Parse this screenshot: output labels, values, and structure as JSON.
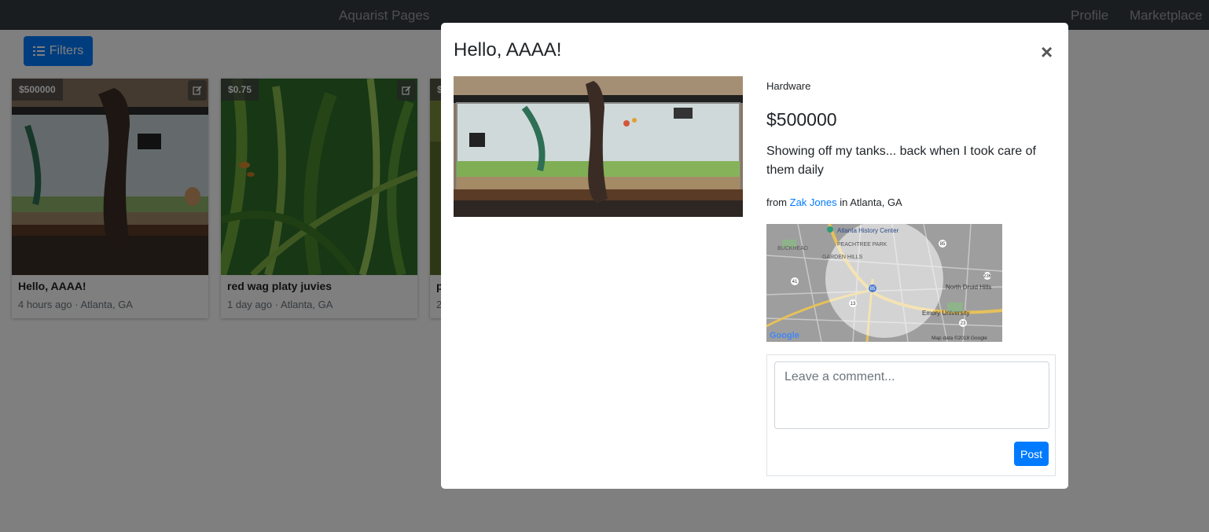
{
  "navbar": {
    "brand": "Aquarist Pages",
    "links": [
      "Profile",
      "Marketplace"
    ]
  },
  "toolbar": {
    "filters_label": "Filters",
    "filters_icon": "list-icon"
  },
  "cards": [
    {
      "price": "$500000",
      "title": "Hello, AAAA!",
      "meta": "4 hours ago · Atlanta, GA",
      "edit_icon": "edit-icon"
    },
    {
      "price": "$0.75",
      "title": "red wag platy juvies",
      "meta": "1 day ago · Atlanta, GA",
      "edit_icon": "edit-icon"
    },
    {
      "price": "$",
      "title": "p",
      "meta": "2",
      "edit_icon": "edit-icon"
    }
  ],
  "modal": {
    "title": "Hello, AAAA!",
    "close_label": "×",
    "category": "Hardware",
    "price": "$500000",
    "description": "Showing off my tanks... back when I took care of them daily",
    "from_prefix": "from",
    "author": "Zak Jones",
    "location_prefix": "in Atlanta, GA",
    "map": {
      "labels": [
        "Atlanta History Center",
        "PEACHTREE PARK",
        "BUCKHEAD",
        "GARDEN HILLS",
        "North Druid Hills",
        "Emory University",
        "Google",
        "Map data ©2018 Google"
      ],
      "shields": [
        "85",
        "41",
        "13",
        "236",
        "23",
        "85"
      ]
    },
    "comment_placeholder": "Leave a comment...",
    "post_label": "Post"
  },
  "colors": {
    "navbar": "#343a40",
    "primary": "#007bff",
    "backdrop": "rgba(0,0,0,0.5)"
  }
}
